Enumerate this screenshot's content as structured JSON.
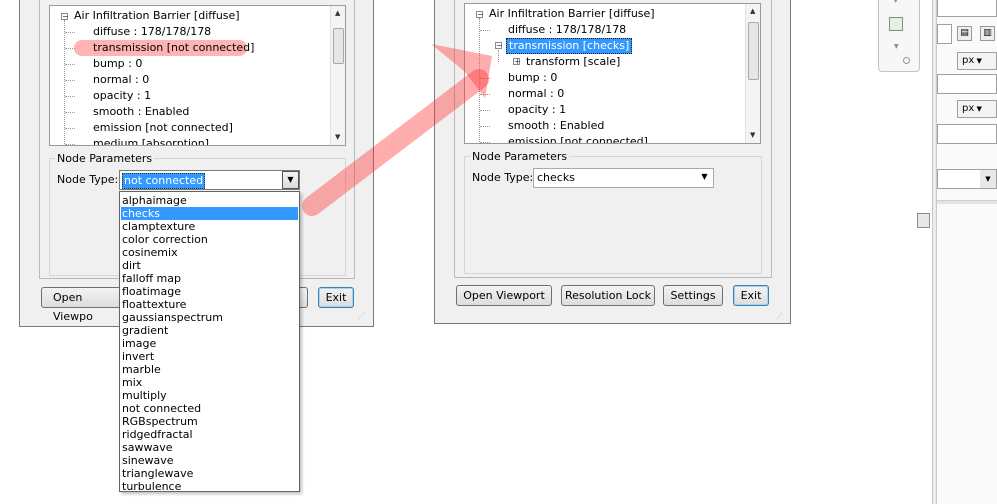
{
  "left_dialog": {
    "tree": {
      "root": "Air Infiltration Barrier  [diffuse]",
      "items": [
        "diffuse : 178/178/178",
        "transmission  [not connected]",
        "bump : 0",
        "normal : 0",
        "opacity : 1",
        "smooth : Enabled",
        "emission  [not connected]",
        "medium  [absorption]"
      ]
    },
    "group_title": "Node Parameters",
    "node_type_label": "Node Type:",
    "node_type_value": "not connected",
    "buttons": {
      "open_viewport": "Open Viewpo",
      "exit": "Exit"
    },
    "dropdown_options": [
      "alphaimage",
      "checks",
      "clamptexture",
      "color correction",
      "cosinemix",
      "dirt",
      "falloff map",
      "floatimage",
      "floattexture",
      "gaussianspectrum",
      "gradient",
      "image",
      "invert",
      "marble",
      "mix",
      "multiply",
      "not connected",
      "RGBspectrum",
      "ridgedfractal",
      "sawwave",
      "sinewave",
      "trianglewave",
      "turbulence"
    ],
    "dropdown_selected": "checks"
  },
  "right_dialog": {
    "tree": {
      "root": "Air Infiltration Barrier  [diffuse]",
      "items": [
        "diffuse : 178/178/178",
        "transmission  [checks]",
        "transform  [scale]",
        "bump : 0",
        "normal : 0",
        "opacity : 1",
        "smooth : Enabled",
        "emission  [not connected]"
      ]
    },
    "group_title": "Node Parameters",
    "node_type_label": "Node Type:",
    "node_type_value": "checks",
    "buttons": {
      "open_viewport": "Open Viewport",
      "resolution_lock": "Resolution Lock",
      "settings": "Settings",
      "exit": "Exit"
    }
  },
  "right_edge": {
    "unit_1": "px",
    "unit_2": "px"
  },
  "colors": {
    "selection": "#3399ff",
    "highlight_arrow": "#ff6666"
  }
}
